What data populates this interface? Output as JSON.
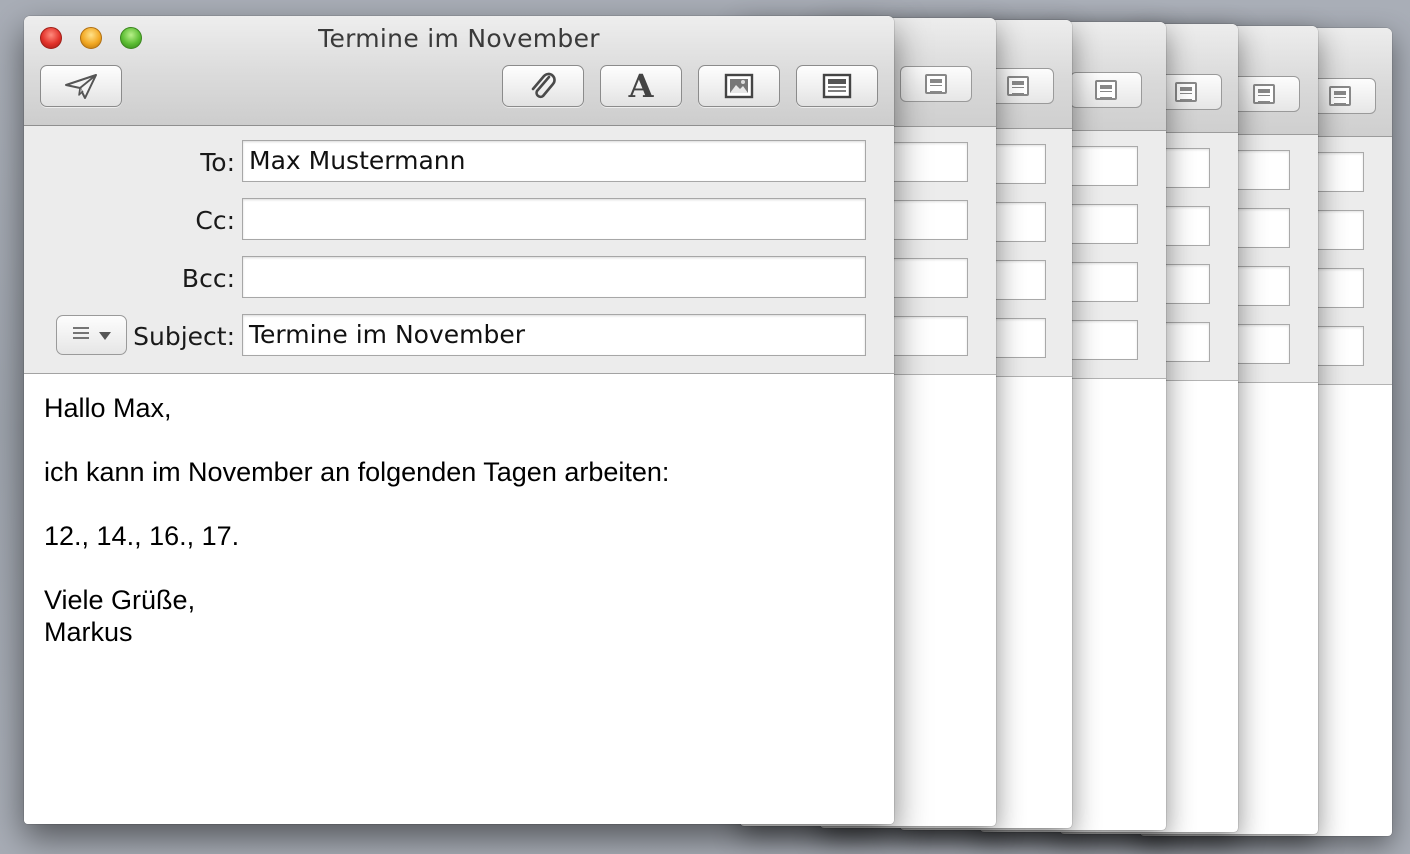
{
  "window": {
    "title": "Termine im November"
  },
  "toolbar": {
    "buttons": [
      "send-icon",
      "attachment-icon",
      "fonts-icon",
      "photo-browser-icon",
      "template-icon"
    ]
  },
  "header": {
    "to_label": "To:",
    "to_value": "Max Mustermann",
    "cc_label": "Cc:",
    "cc_value": "",
    "bcc_label": "Bcc:",
    "bcc_value": "",
    "subject_label": "Subject:",
    "subject_value": "Termine im November",
    "menu_icon": "list-menu-icon"
  },
  "body": {
    "lines": [
      "Hallo Max,",
      "",
      "ich kann im November an folgenden Tagen arbeiten:",
      "",
      "12., 14., 16., 17.",
      "",
      "Viele Grüße,",
      "Markus"
    ]
  }
}
